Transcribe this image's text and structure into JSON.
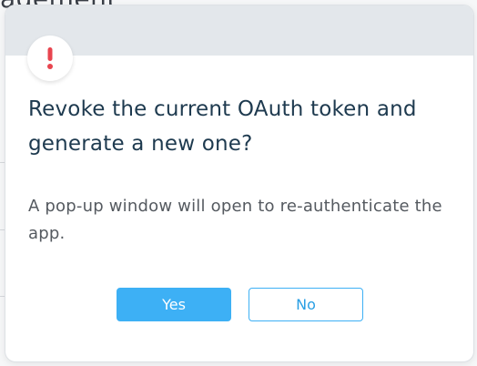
{
  "background": {
    "partial_heading": "agement"
  },
  "dialog": {
    "title": "Revoke the current OAuth token and generate a new one?",
    "message": "A pop-up window will open to re-authenticate the app.",
    "icon": "exclamation-icon",
    "buttons": {
      "yes_label": "Yes",
      "no_label": "No"
    }
  },
  "colors": {
    "accent": "#3db0f5",
    "alert": "#e8454f",
    "title_text": "#1e3a4f",
    "header_band": "#e3e7eb"
  }
}
